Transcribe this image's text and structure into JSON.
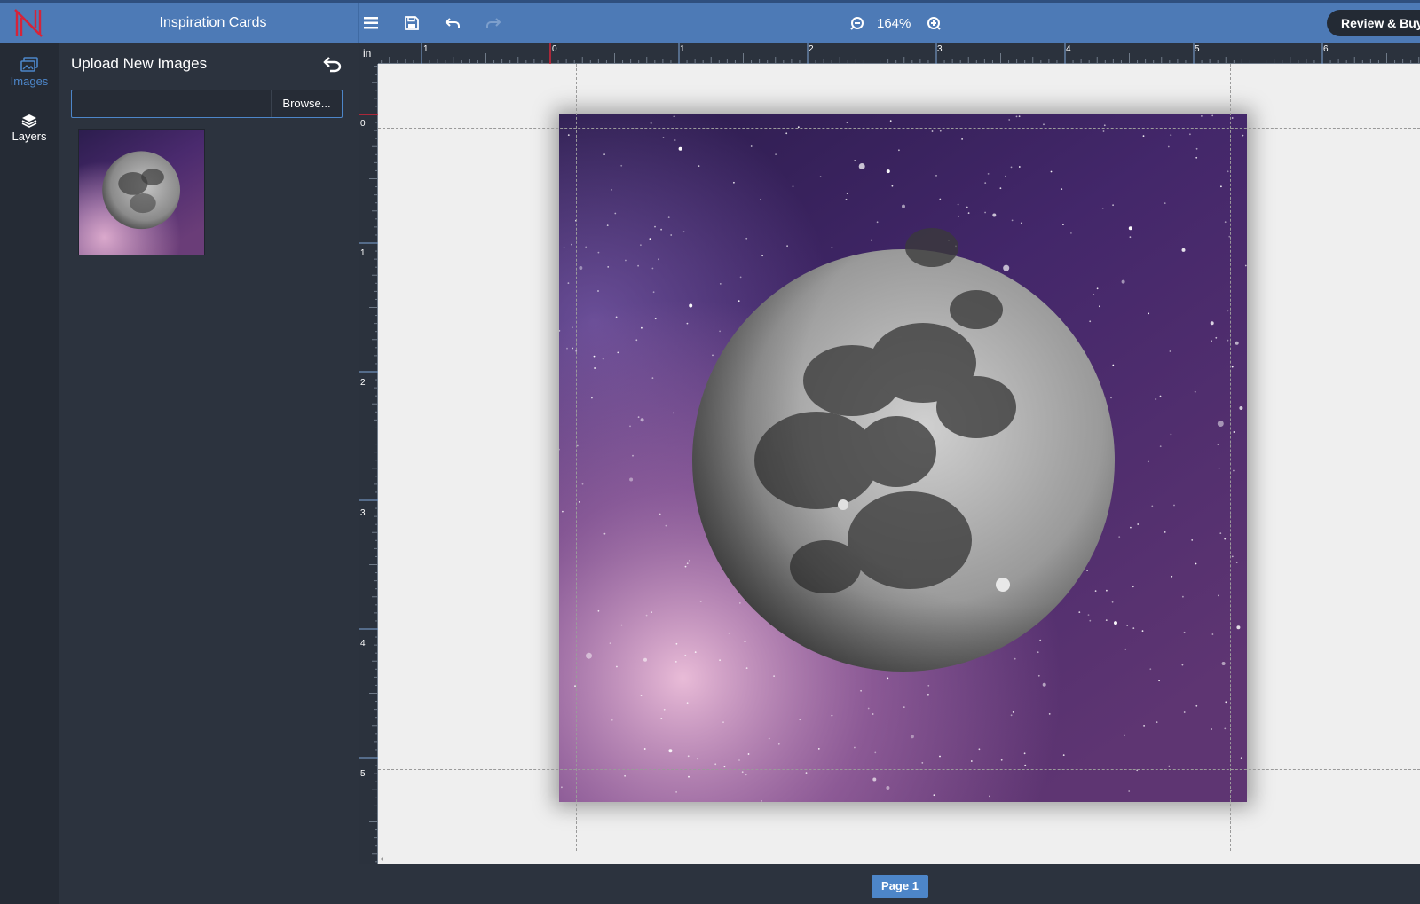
{
  "header": {
    "app_title": "Inspiration Cards",
    "zoom": "164%",
    "review_button": "Review & Buy"
  },
  "rail": {
    "items": [
      {
        "label": "Images",
        "icon": "images-icon",
        "active": true
      },
      {
        "label": "Layers",
        "icon": "layers-icon",
        "active": false
      }
    ]
  },
  "panel": {
    "title": "Upload New Images",
    "upload_value": "",
    "browse_label": "Browse..."
  },
  "ruler": {
    "unit": "in",
    "h_labels": [
      "1",
      "0",
      "1",
      "2",
      "3",
      "4",
      "5",
      "6"
    ],
    "v_labels": [
      "0",
      "1",
      "2",
      "3",
      "4",
      "5"
    ]
  },
  "footer": {
    "page_label": "Page 1"
  },
  "colors": {
    "accent": "#4d86c9",
    "topbar": "#4d7ab6",
    "panel": "#2c333e",
    "logo": "#d5243a"
  }
}
